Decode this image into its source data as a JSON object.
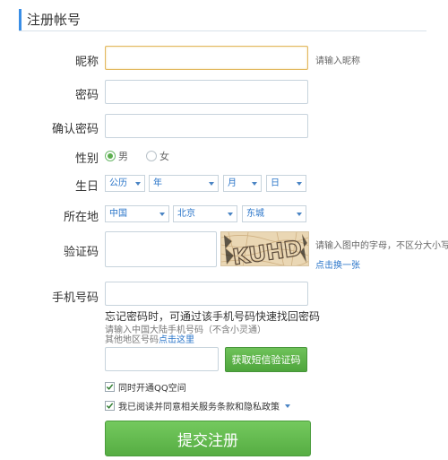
{
  "header": {
    "title": "注册帐号"
  },
  "form": {
    "nickname": {
      "label": "昵称",
      "value": "",
      "hint": "请输入昵称"
    },
    "password": {
      "label": "密码",
      "value": ""
    },
    "confirm_password": {
      "label": "确认密码",
      "value": ""
    },
    "gender": {
      "label": "性别",
      "options": [
        "男",
        "女"
      ],
      "selected": "男"
    },
    "birthday": {
      "label": "生日",
      "calendar": "公历",
      "year": "年",
      "month": "月",
      "day": "日"
    },
    "location": {
      "label": "所在地",
      "country": "中国",
      "province": "北京",
      "district": "东城"
    },
    "captcha": {
      "label": "验证码",
      "value": "",
      "image_text": "KUHD",
      "hint": "请输入图中的字母，不区分大小写",
      "refresh_link": "点击换一张"
    },
    "phone": {
      "label": "手机号码",
      "value": "",
      "note_main": "忘记密码时，可通过该手机号码快速找回密码",
      "note_sub1": "请输入中国大陆手机号码（不含小灵通）",
      "note_sub2_prefix": "其他地区号码",
      "note_sub2_link": "点击这里"
    },
    "sms": {
      "value": "",
      "button": "获取短信验证码"
    },
    "options": {
      "qzone": "同时开通QQ空间",
      "agree": "我已阅读并同意相关服务条款和隐私政策"
    },
    "submit": "提交注册"
  },
  "colors": {
    "accent": "#3a8ee6",
    "button_green": "#5cb248",
    "link": "#2a75c9"
  }
}
